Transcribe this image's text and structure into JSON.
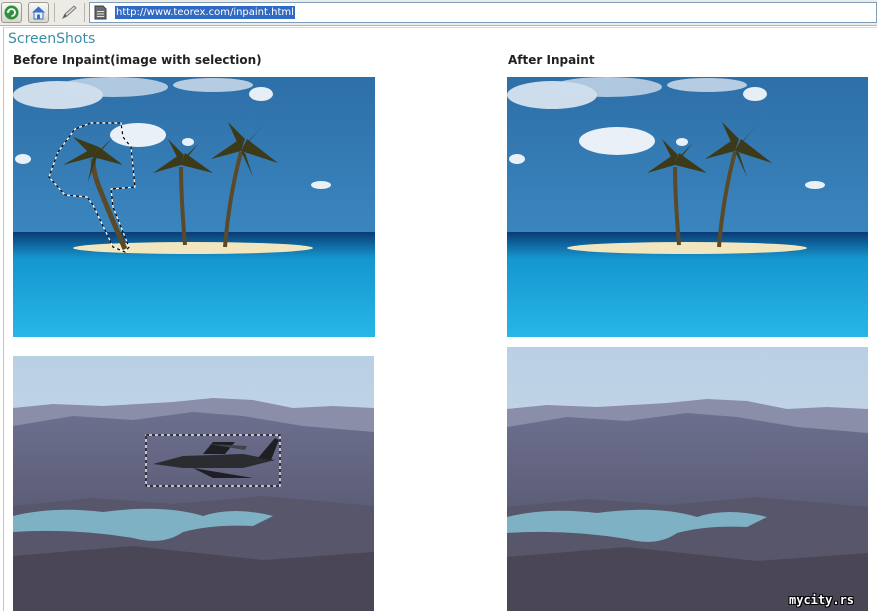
{
  "browser": {
    "url": "http://www.teorex.com/inpaint.html",
    "icons": [
      "refresh-icon",
      "home-icon",
      "pencil-icon",
      "page-icon"
    ]
  },
  "page": {
    "section_title": "ScreenShots",
    "before_label": "Before Inpaint(image with selection)",
    "after_label": "After Inpaint",
    "watermark": "mycity.rs"
  },
  "images": [
    {
      "scene": "tropical-island-with-palm-trees",
      "state": "before",
      "selection": "palm-tree"
    },
    {
      "scene": "tropical-island-with-palm-trees",
      "state": "after",
      "selection": ""
    },
    {
      "scene": "mountain-valley-with-lake",
      "state": "before",
      "selection": "fighter-jet"
    },
    {
      "scene": "mountain-valley-with-lake",
      "state": "after",
      "selection": ""
    }
  ]
}
